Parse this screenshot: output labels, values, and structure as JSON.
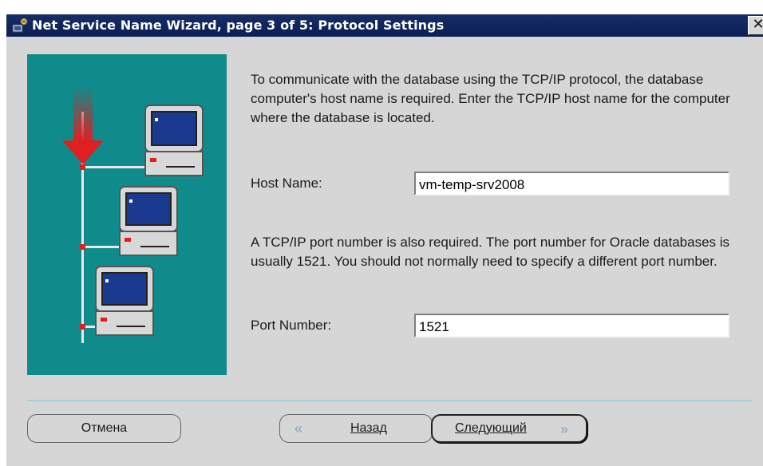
{
  "window": {
    "title": "Net Service Name Wizard, page 3 of 5: Protocol Settings",
    "close_glyph": "✕"
  },
  "content": {
    "intro_text": "To communicate with the database using the TCP/IP protocol, the database computer's host name is required.  Enter the TCP/IP host name for the computer where the database is located.",
    "host_label": "Host Name:",
    "host_value": "vm-temp-srv2008",
    "port_text": "A TCP/IP port number is also required.  The port number for Oracle databases is usually 1521.  You should not normally need to specify a different port number.",
    "port_label": "Port Number:",
    "port_value": "1521"
  },
  "buttons": {
    "cancel": "Отмена",
    "back": "Назад",
    "back_chevron": "«",
    "next": "Следующий",
    "next_chevron": "»"
  },
  "icons": [
    "wizard-icon",
    "network-illustration",
    "close-icon",
    "chevron-left-icon",
    "chevron-right-icon"
  ],
  "colors": {
    "titlebar": "#0b1f55",
    "illustration_bg": "#0f8b8b",
    "window_bg": "#d6d6d6",
    "arrow": "#e02020",
    "screen": "#1a3a8f"
  }
}
